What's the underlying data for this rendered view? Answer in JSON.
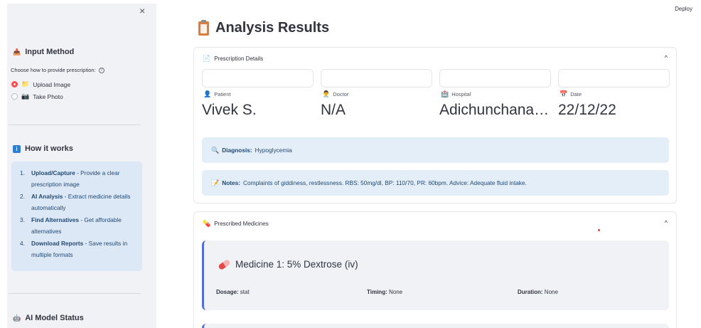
{
  "sidebar": {
    "close_icon": "×",
    "input_method": {
      "title": "Input Method",
      "help": "Choose how to provide prescription:",
      "options": [
        {
          "label": "Upload Image",
          "icon": "📁",
          "checked": true
        },
        {
          "label": "Take Photo",
          "icon": "📷",
          "checked": false
        }
      ]
    },
    "how_it_works": {
      "title": "How it works",
      "steps": [
        {
          "num": "1.",
          "bold": "Upload/Capture",
          "rest": " - Provide a clear prescription image"
        },
        {
          "num": "2.",
          "bold": "AI Analysis",
          "rest": " - Extract medicine details automatically"
        },
        {
          "num": "3.",
          "bold": "Find Alternatives",
          "rest": " - Get affordable alternatives"
        },
        {
          "num": "4.",
          "bold": "Download Reports",
          "rest": " - Save results in multiple formats"
        }
      ]
    },
    "model_status": {
      "title": "AI Model Status"
    }
  },
  "header": {
    "deploy_label": "Deploy",
    "title": "Analysis Results"
  },
  "prescription": {
    "section_title": "Prescription Details",
    "fields": [
      {
        "label": "Patient",
        "value": "Vivek S."
      },
      {
        "label": "Doctor",
        "value": "N/A"
      },
      {
        "label": "Hospital",
        "value": "Adichunchanagiri"
      },
      {
        "label": "Date",
        "value": "22/12/22"
      }
    ],
    "diagnosis": {
      "label": "Diagnosis:",
      "value": "Hypoglycemia"
    },
    "notes": {
      "label": "Notes:",
      "value": "Complaints of giddiness, restlessness. RBS: 50mg/dl, BP: 110/70, PR: 60bpm. Advice: Adequate fluid intake."
    }
  },
  "medicines": {
    "section_title": "Prescribed Medicines",
    "items": [
      {
        "title": "Medicine 1: 5% Dextrose (iv)",
        "dosage_label": "Dosage:",
        "dosage": "stat",
        "timing_label": "Timing:",
        "timing": "None",
        "duration_label": "Duration:",
        "duration": "None"
      }
    ]
  },
  "colors": {
    "accent": "#ff4b4b",
    "info_bg": "#e3eef9",
    "card_border": "#4f6fd7",
    "sidebar_bg": "#f0f2f6"
  }
}
